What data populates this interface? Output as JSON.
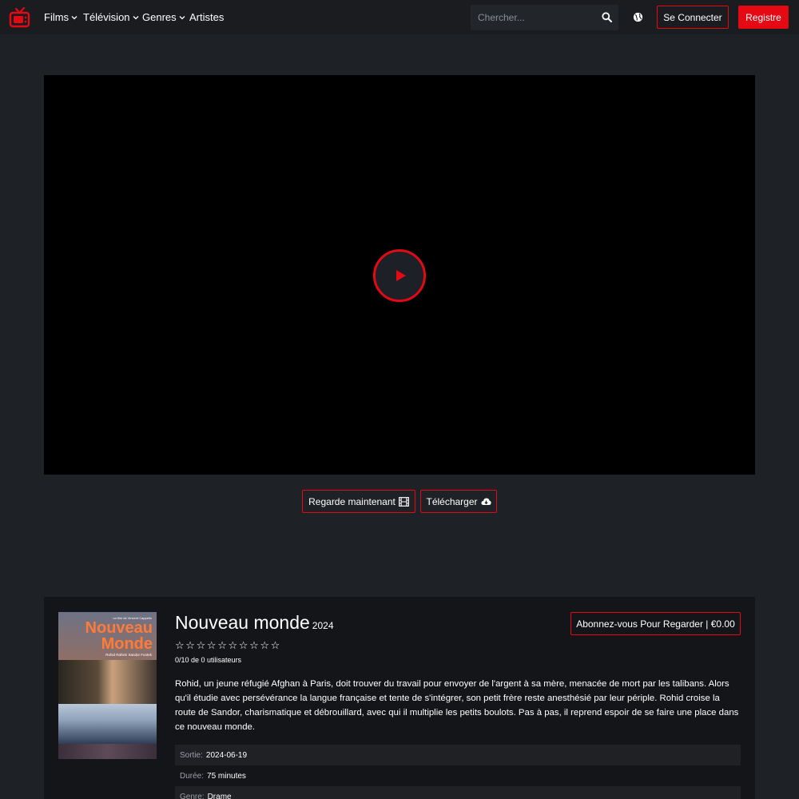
{
  "nav": {
    "menu": [
      {
        "label": "Films",
        "dropdown": true
      },
      {
        "label": "Télévision",
        "dropdown": true
      },
      {
        "label": "Genres",
        "dropdown": true
      },
      {
        "label": "Artistes",
        "dropdown": false
      }
    ],
    "search_placeholder": "Chercher...",
    "login_label": "Se Connecter",
    "register_label": "Registre",
    "icons": [
      "tv-logo-icon",
      "search-icon",
      "globe-icon"
    ]
  },
  "player": {
    "actions": [
      {
        "label": "Regarde maintenant",
        "icon": "film-icon"
      },
      {
        "label": "Télécharger",
        "icon": "cloud-download-icon"
      }
    ]
  },
  "movie": {
    "poster": {
      "credit": "un film de Vincent Cappello",
      "title_line1": "Nouveau",
      "title_line2": "Monde",
      "cast": "Rohid Rahimi   Sandor Funtek"
    },
    "title": "Nouveau monde",
    "year": "2024",
    "stars": [
      "☆",
      "☆",
      "☆",
      "☆",
      "☆",
      "☆",
      "☆",
      "☆",
      "☆",
      "☆"
    ],
    "rating_text": "0/10 de 0 utilisateurs",
    "subscribe_label": "Abonnez-vous Pour Regarder | €0.00",
    "synopsis": "Rohid, un jeune réfugié Afghan à Paris, doit trouver du travail pour envoyer de l'argent à sa mère, menacée de mort par les talibans. Alors qu'il étudie avec persévérance la langue française et tente de s'intégrer, son petit frère reste anesthésié par leur périple. Rohid croise la route de Sandor, charismatique et débrouillard, avec qui il multiplie les petits boulots. Pas à pas, il reprend espoir de se faire une place dans ce nouveau monde.",
    "details": [
      {
        "label": "Sortie:",
        "value": "2024-06-19"
      },
      {
        "label": "Durée:",
        "value": "75 minutes"
      },
      {
        "label": "Genre:",
        "value": "Drame"
      }
    ]
  },
  "colors": {
    "accent": "#e50914",
    "background": "#1e2126",
    "card": "#141518"
  }
}
